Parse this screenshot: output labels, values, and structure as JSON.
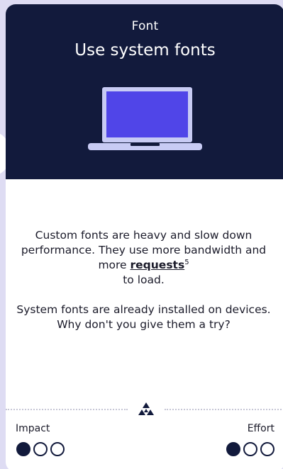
{
  "card": {
    "category": "Font",
    "title": "Use system fonts",
    "illustration": "laptop-icon",
    "paragraph1_before_link": "Custom fonts are heavy and slow down performance. They use more bandwidth and more ",
    "paragraph1_link": "requests",
    "paragraph1_footnote": "5",
    "paragraph1_after_link": " to load.",
    "paragraph2": "System fonts are already installed on devices. Why don't you give them a try?"
  },
  "ratings": {
    "impact": {
      "label": "Impact",
      "value": 1,
      "max": 3
    },
    "effort": {
      "label": "Effort",
      "value": 1,
      "max": 3
    }
  },
  "colors": {
    "header_bg": "#121a3c",
    "laptop_screen": "#5045e8",
    "laptop_frame": "#c8cbf4",
    "page_bg": "#dedcf3"
  }
}
